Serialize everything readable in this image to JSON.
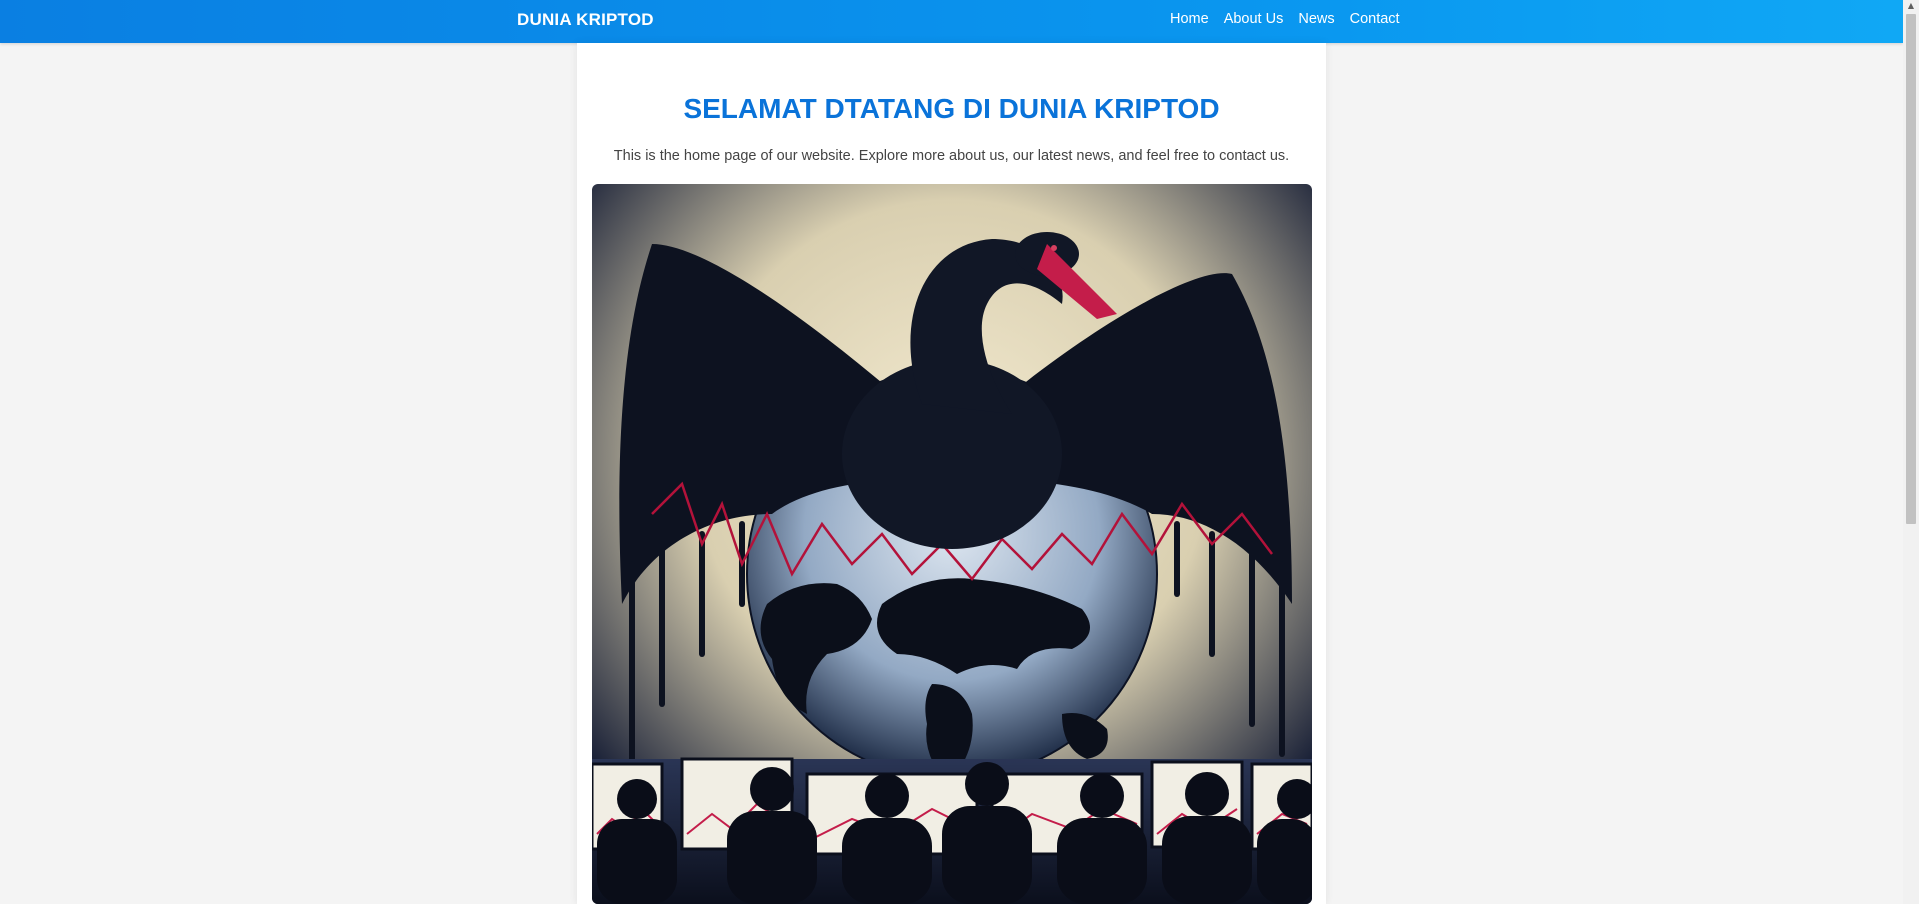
{
  "brand": "DUNIA KRIPTOD",
  "nav": [
    {
      "label": "Home"
    },
    {
      "label": "About Us"
    },
    {
      "label": "News"
    },
    {
      "label": "Contact"
    }
  ],
  "main": {
    "title": "SELAMAT DTATANG DI DUNIA KRIPTOD",
    "intro": "This is the home page of our website. Explore more about us, our latest news, and feel free to contact us."
  },
  "colors": {
    "header_gradient_start": "#0a7fe2",
    "header_gradient_end": "#10a8f5",
    "title": "#0a73d9",
    "page_background": "#f4f4f4"
  },
  "hero_image": {
    "subject": "black swan with spread wings over a world globe, red stock charts, people watching trading screens"
  }
}
